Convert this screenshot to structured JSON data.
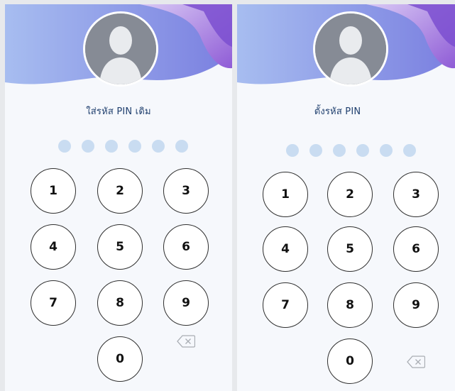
{
  "panels": [
    {
      "title": "ใส่รหัส PIN เดิม",
      "pin_dots_filled": 0,
      "pin_dots_total": 6,
      "keys": [
        "1",
        "2",
        "3",
        "4",
        "5",
        "6",
        "7",
        "8",
        "9",
        "0"
      ]
    },
    {
      "title": "ตั้งรหัส PIN",
      "pin_dots_filled": 0,
      "pin_dots_total": 6,
      "keys": [
        "1",
        "2",
        "3",
        "4",
        "5",
        "6",
        "7",
        "8",
        "9",
        "0"
      ]
    }
  ],
  "icons": {
    "avatar": "avatar-placeholder-icon",
    "backspace": "backspace-icon"
  },
  "colors": {
    "panel_background": "#f6f8fc",
    "wave_light": "#9fb4ee",
    "wave_mid": "#7d86e3",
    "wave_accent": "#8b5fd6",
    "title_text": "#1f3f6e",
    "pin_dot": "#c9dcf1",
    "key_border": "#2f2f2f"
  }
}
